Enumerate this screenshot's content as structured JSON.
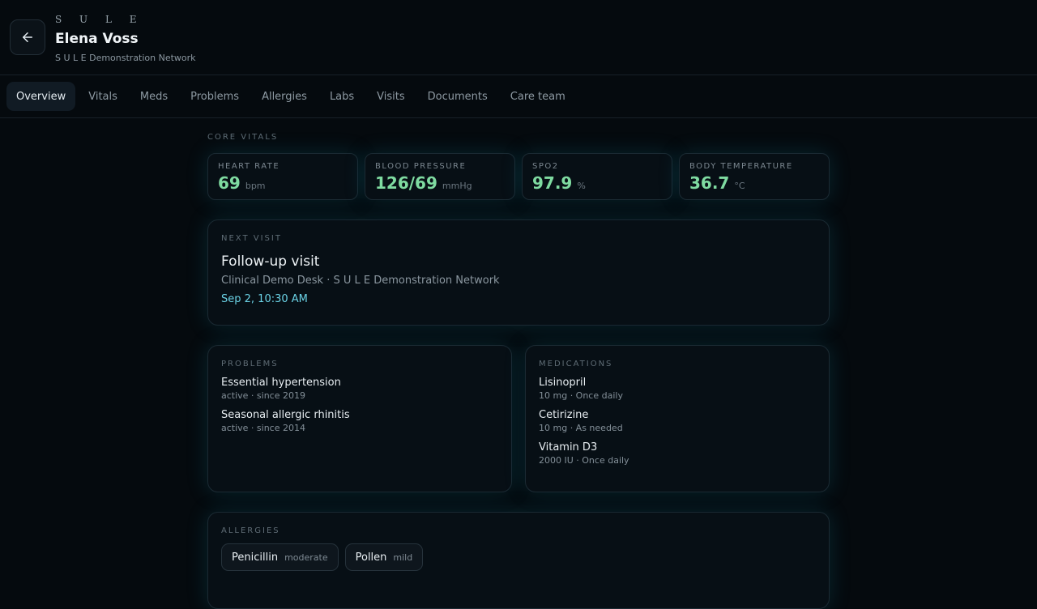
{
  "header": {
    "brand": "S U L E",
    "patient_name": "Elena Voss",
    "network": "S U L E Demonstration Network"
  },
  "tabs": [
    {
      "label": "Overview",
      "active": true
    },
    {
      "label": "Vitals"
    },
    {
      "label": "Meds"
    },
    {
      "label": "Problems"
    },
    {
      "label": "Allergies"
    },
    {
      "label": "Labs"
    },
    {
      "label": "Visits"
    },
    {
      "label": "Documents"
    },
    {
      "label": "Care team"
    }
  ],
  "core_vitals": {
    "label": "CORE VITALS",
    "items": [
      {
        "label": "HEART RATE",
        "value": "69",
        "unit": "bpm"
      },
      {
        "label": "BLOOD PRESSURE",
        "value": "126/69",
        "unit": "mmHg"
      },
      {
        "label": "SPO2",
        "value": "97.9",
        "unit": "%"
      },
      {
        "label": "BODY TEMPERATURE",
        "value": "36.7",
        "unit": "°C"
      }
    ]
  },
  "next_visit": {
    "label": "NEXT VISIT",
    "title": "Follow-up visit",
    "location": "Clinical Demo Desk · S U L E Demonstration Network",
    "time": "Sep 2, 10:30 AM"
  },
  "problems": {
    "label": "PROBLEMS",
    "items": [
      {
        "title": "Essential hypertension",
        "sub": "active · since 2019"
      },
      {
        "title": "Seasonal allergic rhinitis",
        "sub": "active · since 2014"
      }
    ]
  },
  "medications": {
    "label": "MEDICATIONS",
    "items": [
      {
        "title": "Lisinopril",
        "sub": "10 mg · Once daily"
      },
      {
        "title": "Cetirizine",
        "sub": "10 mg · As needed"
      },
      {
        "title": "Vitamin D3",
        "sub": "2000 IU · Once daily"
      }
    ]
  },
  "allergies": {
    "label": "ALLERGIES",
    "items": [
      {
        "name": "Penicillin",
        "severity": "moderate"
      },
      {
        "name": "Pollen",
        "severity": "mild"
      }
    ]
  },
  "colors": {
    "accent_value": "#7fdba1",
    "accent_time": "#6bd3e6",
    "background": "#050a0e"
  }
}
